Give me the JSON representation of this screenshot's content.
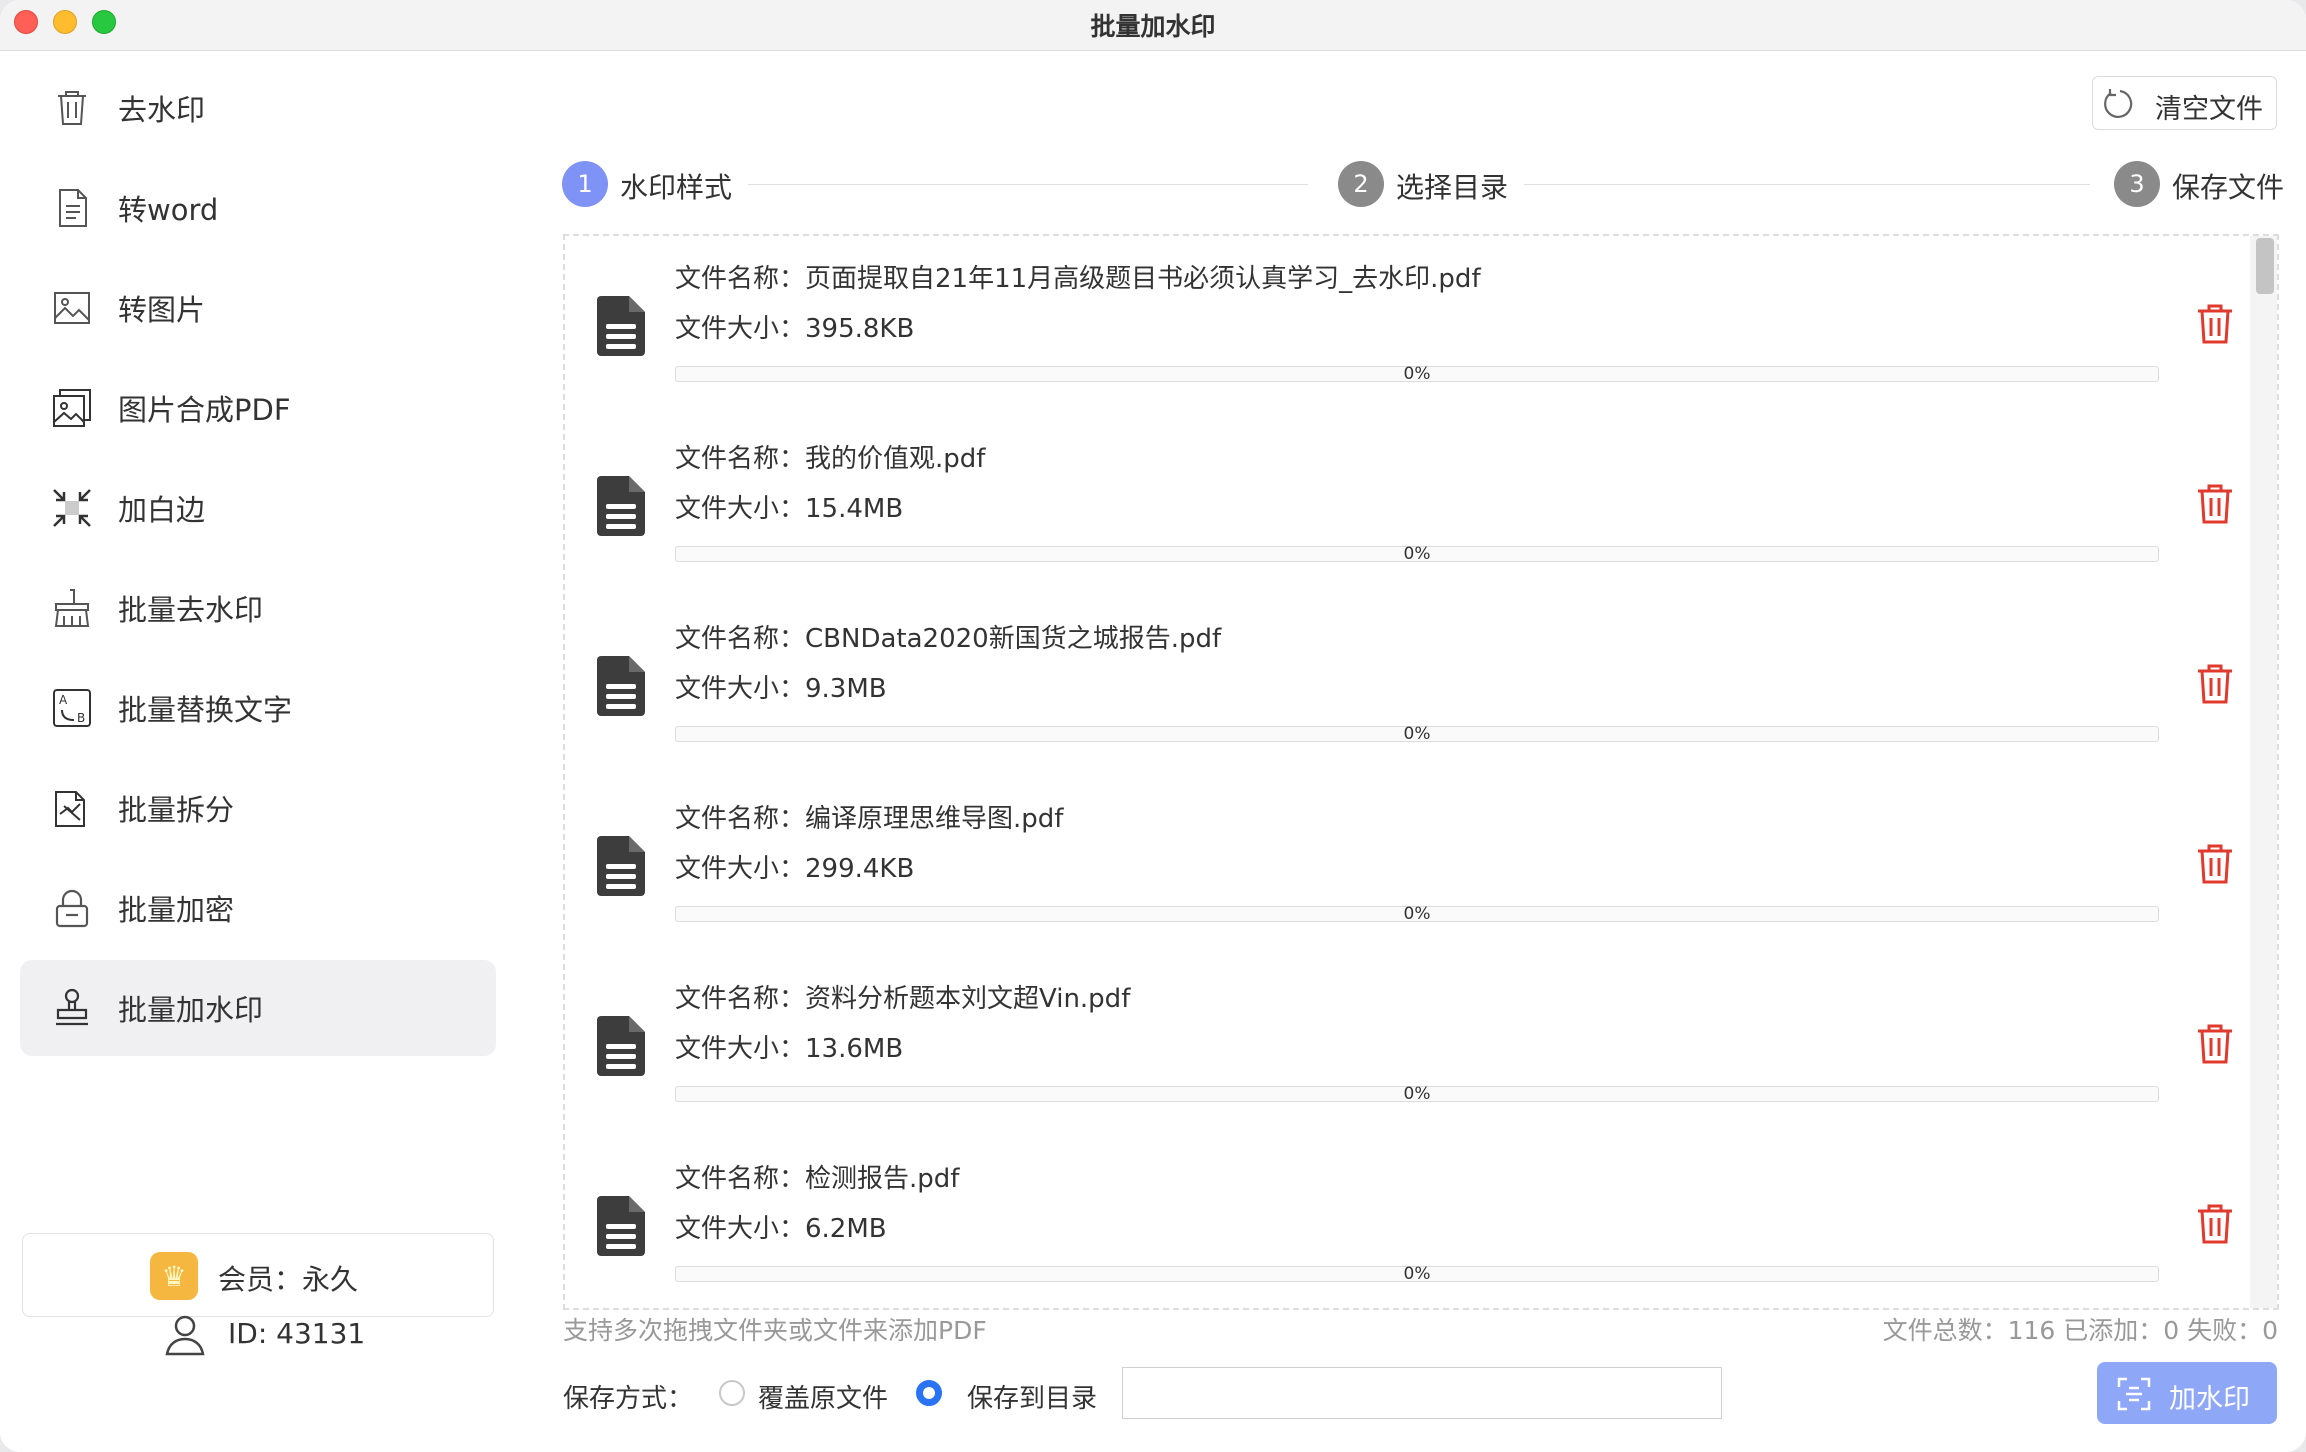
{
  "window": {
    "title": "批量加水印"
  },
  "sidebar": {
    "items": [
      {
        "label": "去水印",
        "icon": "trash-can-icon"
      },
      {
        "label": "转word",
        "icon": "document-icon"
      },
      {
        "label": "转图片",
        "icon": "image-icon"
      },
      {
        "label": "图片合成PDF",
        "icon": "image-stack-icon"
      },
      {
        "label": "加白边",
        "icon": "compress-arrows-icon"
      },
      {
        "label": "批量去水印",
        "icon": "broom-icon"
      },
      {
        "label": "批量替换文字",
        "icon": "replace-text-icon"
      },
      {
        "label": "批量拆分",
        "icon": "split-document-icon"
      },
      {
        "label": "批量加密",
        "icon": "lock-icon"
      },
      {
        "label": "批量加水印",
        "icon": "stamp-icon",
        "active": true
      }
    ],
    "member": {
      "label": "会员：永久"
    },
    "user": {
      "id": "ID: 43131"
    }
  },
  "toolbar": {
    "clear_label": "清空文件"
  },
  "steps": [
    {
      "num": "1",
      "label": "水印样式",
      "color": "#7e93f5"
    },
    {
      "num": "2",
      "label": "选择目录",
      "color": "#8a8a8a"
    },
    {
      "num": "3",
      "label": "保存文件",
      "color": "#8a8a8a"
    }
  ],
  "files": [
    {
      "name": "文件名称：页面提取自21年11月高级题目书必须认真学习_去水印.pdf",
      "size": "文件大小：395.8KB",
      "progress": "0%",
      "progress_value": 0
    },
    {
      "name": "文件名称：我的价值观.pdf",
      "size": "文件大小：15.4MB",
      "progress": "0%",
      "progress_value": 0
    },
    {
      "name": "文件名称：CBNData2020新国货之城报告.pdf",
      "size": "文件大小：9.3MB",
      "progress": "0%",
      "progress_value": 0
    },
    {
      "name": "文件名称：编译原理思维导图.pdf",
      "size": "文件大小：299.4KB",
      "progress": "0%",
      "progress_value": 0
    },
    {
      "name": "文件名称：资料分析题本刘文超Vin.pdf",
      "size": "文件大小：13.6MB",
      "progress": "0%",
      "progress_value": 0
    },
    {
      "name": "文件名称：检测报告.pdf",
      "size": "文件大小：6.2MB",
      "progress": "0%",
      "progress_value": 0
    }
  ],
  "footer": {
    "hint": "支持多次拖拽文件夹或文件来添加PDF",
    "counts": "文件总数：116 已添加：0 失败：0",
    "save_mode_label": "保存方式：",
    "option_overwrite": "覆盖原文件",
    "option_directory": "保存到目录",
    "selected_option": "保存到目录",
    "directory_value": "",
    "action_label": "加水印"
  },
  "colors": {
    "accent": "#8fa7f7",
    "danger": "#e03a2f",
    "radio_selected": "#2a73f5"
  }
}
